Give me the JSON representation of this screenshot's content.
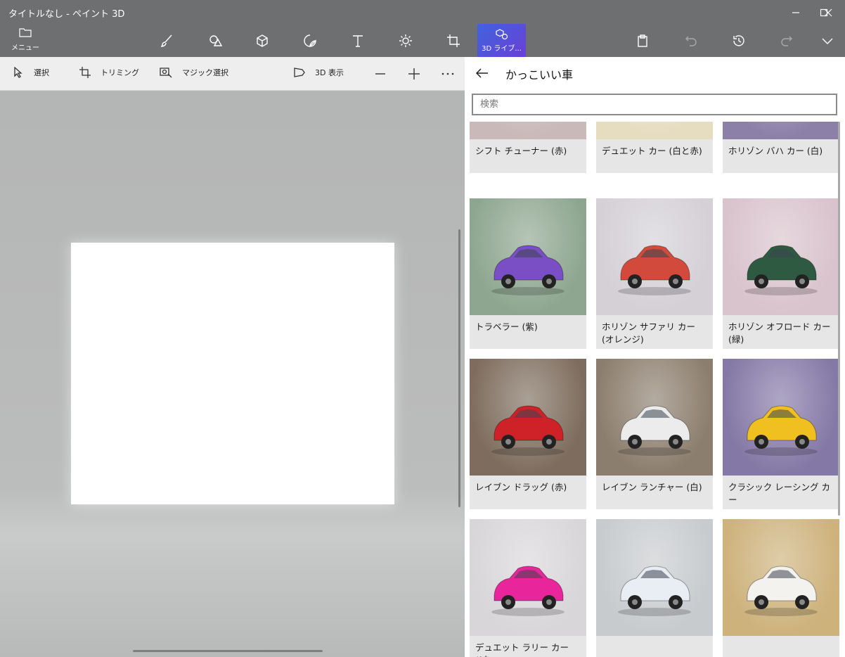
{
  "window": {
    "title": "タイトルなし - ペイント 3D"
  },
  "ribbon": {
    "menu_label": "メニュー",
    "tools": [
      {
        "name": "brushes",
        "icon": "brush-icon"
      },
      {
        "name": "2d-shapes",
        "icon": "2d-shapes-icon"
      },
      {
        "name": "3d-shapes",
        "icon": "cube-icon"
      },
      {
        "name": "stickers",
        "icon": "sticker-icon"
      },
      {
        "name": "text",
        "icon": "text-icon"
      },
      {
        "name": "effects",
        "icon": "sun-icon"
      },
      {
        "name": "canvas",
        "icon": "canvas-icon"
      },
      {
        "name": "3d-library",
        "icon": "3d-library-icon",
        "label": "3D ライブ..."
      }
    ],
    "accent_gradient": [
      "#3f64dc",
      "#6a3fd8"
    ]
  },
  "subbar": {
    "select_label": "選択",
    "crop_label": "トリミング",
    "magic_select_label": "マジック選択",
    "view3d_label": "3D 表示"
  },
  "panel": {
    "title": "かっこいい車",
    "search_placeholder": "検索",
    "items": [
      {
        "label": "シフト チューナー (赤)",
        "bg": "#c9b9b8",
        "car": "#d8261e"
      },
      {
        "label": "デュエット カー (白と赤)",
        "bg": "#e6dcc0",
        "car": "#f4f4f4"
      },
      {
        "label": "ホリゾン バハ カー (白)",
        "bg": "#8c80a9",
        "car": "#dfe4ee"
      },
      {
        "label": "トラベラー (紫)",
        "bg": "#8ea68f",
        "car": "#7a4fc6"
      },
      {
        "label": "ホリゾン サファリ カー (オレンジ)",
        "bg": "#d4d0d6",
        "car": "#d14a3b"
      },
      {
        "label": "ホリゾン オフロード カー (緑)",
        "bg": "#d9c3cc",
        "car": "#2f5a42"
      },
      {
        "label": "レイブン ドラッグ (赤)",
        "bg": "#7e6d5e",
        "car": "#cf2228"
      },
      {
        "label": "レイブン ランチャー (白)",
        "bg": "#8c7e6e",
        "car": "#ececec"
      },
      {
        "label": "クラシック レーシング カー",
        "bg": "#8478a6",
        "car": "#f0c020"
      },
      {
        "label": "デュエット ラリー カー (ピン",
        "bg": "#d9d6da",
        "car": "#e8259a"
      },
      {
        "label": "",
        "bg": "#c8cbce",
        "car": "#e9eef4"
      },
      {
        "label": "",
        "bg": "#cdb27c",
        "car": "#f4f2ee"
      }
    ]
  }
}
